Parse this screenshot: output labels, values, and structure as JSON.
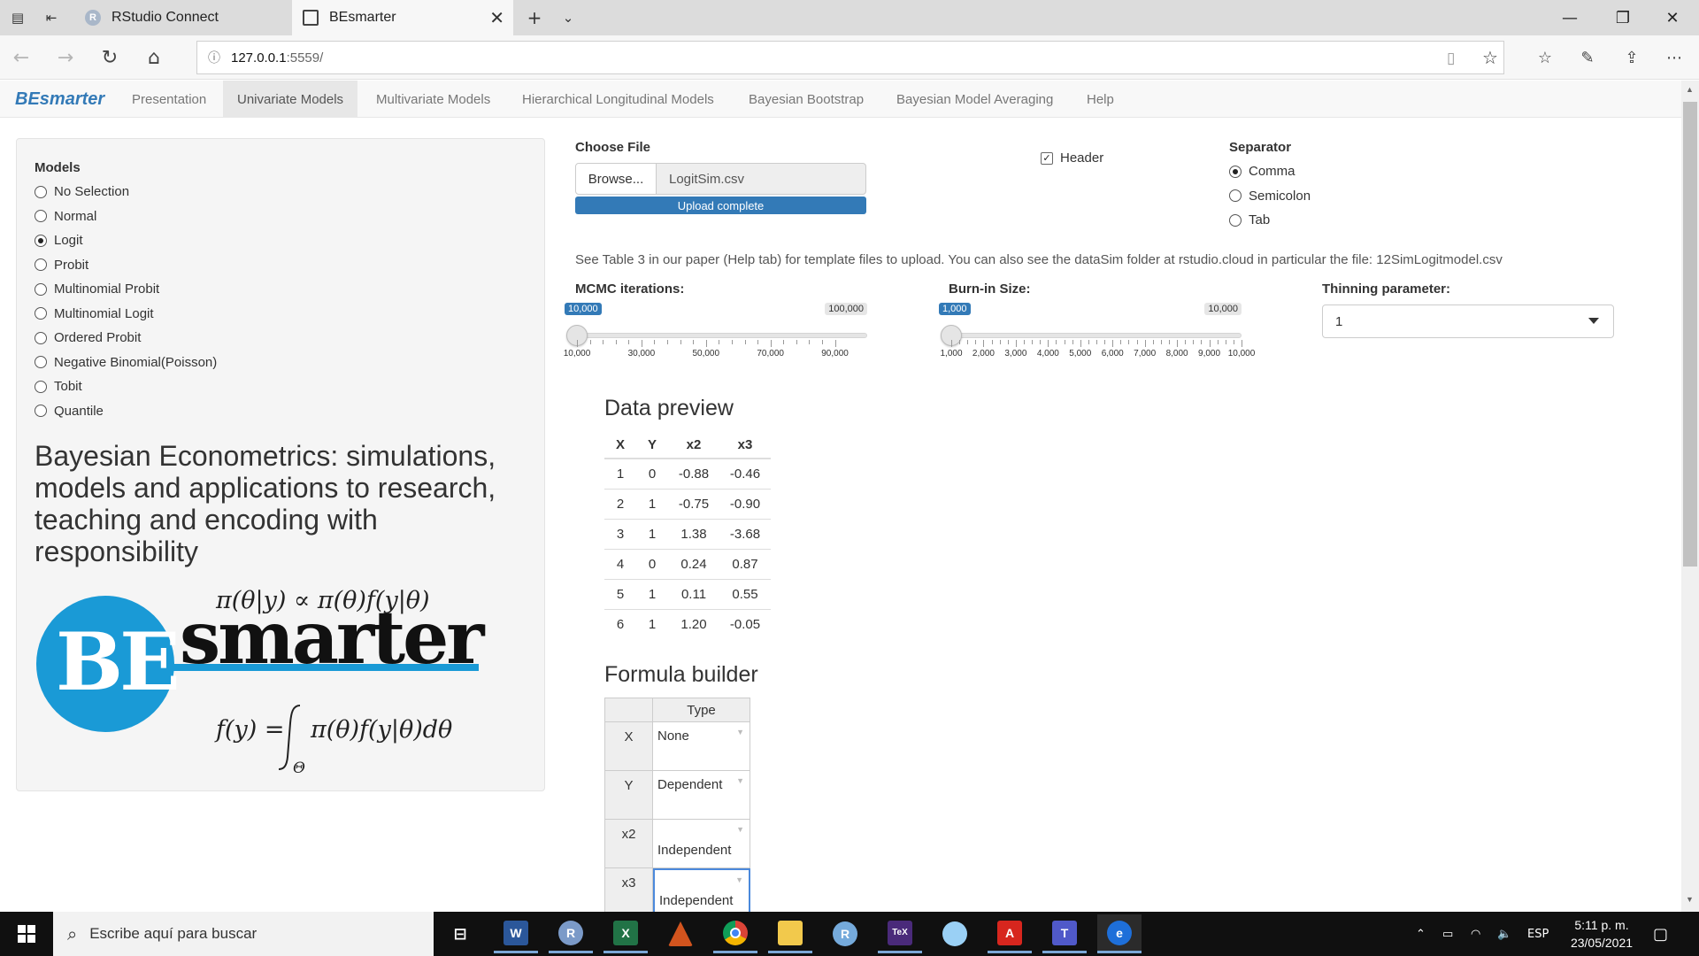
{
  "browser": {
    "tabs": [
      {
        "label": "RStudio Connect",
        "icon": "r-icon"
      },
      {
        "label": "BEsmarter",
        "icon": "page-icon"
      }
    ],
    "url_host": "127.0.0.1",
    "url_port": ":5559/"
  },
  "app": {
    "brand": "BEsmarter",
    "nav": [
      "Presentation",
      "Univariate Models",
      "Multivariate Models",
      "Hierarchical Longitudinal Models",
      "Bayesian Bootstrap",
      "Bayesian Model Averaging",
      "Help"
    ],
    "active_nav": "Univariate Models"
  },
  "sidebar": {
    "models_label": "Models",
    "models": [
      "No Selection",
      "Normal",
      "Logit",
      "Probit",
      "Multinomial Probit",
      "Multinomial Logit",
      "Ordered Probit",
      "Negative Binomial(Poisson)",
      "Tobit",
      "Quantile"
    ],
    "selected_model": "Logit",
    "title": "Bayesian Econometrics: simulations, models and applications to research, teaching and encoding with responsibility",
    "logo": {
      "be": "BE",
      "smarter": "smarter",
      "formula_top": "π(θ|y) ∝ π(θ)f(y|θ)",
      "formula_bottom_lhs": "f(y) =",
      "formula_bottom_rhs": "π(θ)f(y|θ)dθ",
      "integral_sub": "Θ"
    }
  },
  "upload": {
    "label": "Choose File",
    "browse": "Browse...",
    "filename": "LogitSim.csv",
    "progress": "Upload complete",
    "header_label": "Header",
    "header_checked": true,
    "separator_label": "Separator",
    "separators": [
      "Comma",
      "Semicolon",
      "Tab"
    ],
    "selected_separator": "Comma",
    "help": "See Table 3 in our paper (Help tab) for template files to upload. You can also see the dataSim folder at rstudio.cloud in particular the file: 12SimLogitmodel.csv"
  },
  "sliders": {
    "mcmc": {
      "label": "MCMC iterations:",
      "value": "10,000",
      "max": "100,000",
      "ticks": [
        "10,000",
        "30,000",
        "50,000",
        "70,000",
        "90,000"
      ],
      "fraction": 0
    },
    "burnin": {
      "label": "Burn-in Size:",
      "value": "1,000",
      "max": "10,000",
      "ticks": [
        "1,000",
        "2,000",
        "3,000",
        "4,000",
        "5,000",
        "6,000",
        "7,000",
        "8,000",
        "9,000",
        "10,000"
      ],
      "fraction": 0
    }
  },
  "thinning": {
    "label": "Thinning parameter:",
    "value": "1"
  },
  "preview": {
    "title": "Data preview",
    "columns": [
      "X",
      "Y",
      "x2",
      "x3"
    ],
    "rows": [
      [
        "1",
        "0",
        "-0.88",
        "-0.46"
      ],
      [
        "2",
        "1",
        "-0.75",
        "-0.90"
      ],
      [
        "3",
        "1",
        "1.38",
        "-3.68"
      ],
      [
        "4",
        "0",
        "0.24",
        "0.87"
      ],
      [
        "5",
        "1",
        "0.11",
        "0.55"
      ],
      [
        "6",
        "1",
        "1.20",
        "-0.05"
      ]
    ]
  },
  "formula": {
    "title": "Formula builder",
    "type_header": "Type",
    "rows": [
      {
        "var": "X",
        "type": "None"
      },
      {
        "var": "Y",
        "type": "Dependent"
      },
      {
        "var": "x2",
        "type": "Independent"
      },
      {
        "var": "x3",
        "type": "Independent"
      }
    ]
  },
  "taskbar": {
    "search_placeholder": "Escribe aquí para buscar",
    "lang": "ESP",
    "time": "5:11 p. m.",
    "date": "23/05/2021"
  },
  "colors": {
    "accent": "#337ab7",
    "logo_blue": "#1a9ad6"
  }
}
